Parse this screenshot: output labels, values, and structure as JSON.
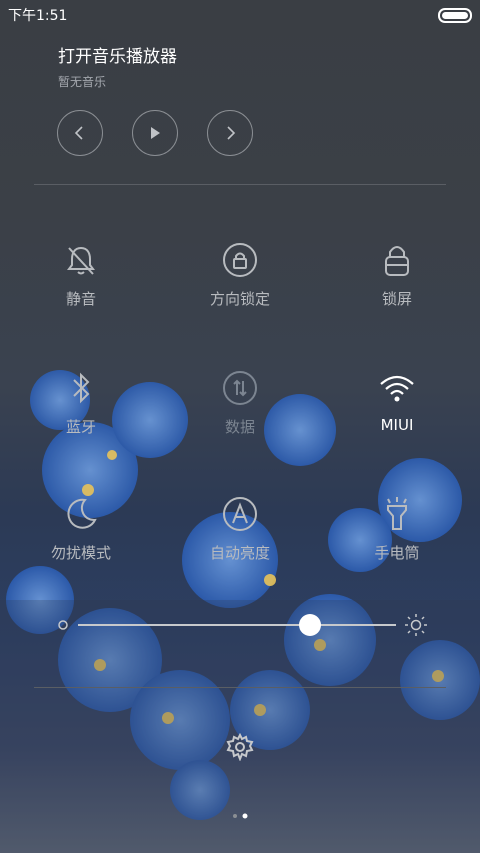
{
  "status_bar": {
    "time": "下午1:51"
  },
  "music": {
    "title": "打开音乐播放器",
    "subtitle": "暂无音乐",
    "controls": [
      "prev-icon",
      "play-icon",
      "next-icon"
    ]
  },
  "toggles": [
    {
      "label": "静音",
      "icon": "bell-mute-icon",
      "active": false
    },
    {
      "label": "方向锁定",
      "icon": "rotation-lock-icon",
      "active": false
    },
    {
      "label": "锁屏",
      "icon": "lock-icon",
      "active": false
    },
    {
      "label": "蓝牙",
      "icon": "bluetooth-icon",
      "active": false
    },
    {
      "label": "数据",
      "icon": "data-icon",
      "active": false
    },
    {
      "label": "MIUI",
      "icon": "wifi-icon",
      "active": true
    },
    {
      "label": "勿扰模式",
      "icon": "moon-icon",
      "active": false
    },
    {
      "label": "自动亮度",
      "icon": "auto-brightness-icon",
      "active": false
    },
    {
      "label": "手电筒",
      "icon": "flashlight-icon",
      "active": false
    }
  ],
  "brightness": {
    "level": 0.73
  },
  "footer": {
    "settings_icon": "gear-icon",
    "pages": 2,
    "current_page": 2
  },
  "colors": {
    "accent_on": "#ffffff",
    "inactive": "#b8bbbf"
  }
}
